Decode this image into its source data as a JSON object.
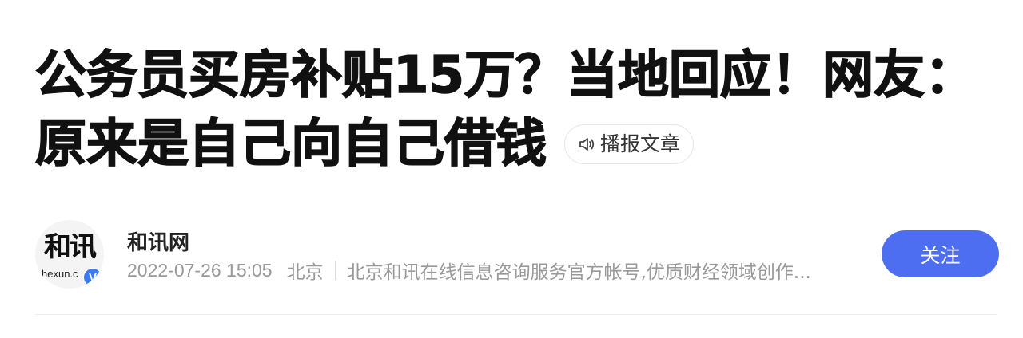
{
  "article": {
    "title_line1": "公务员买房补贴15万？当地回应！网友：",
    "title_line2": "原来是自己向自己借钱",
    "tts_button_label": "播报文章",
    "tts_icon": "speaker-icon"
  },
  "author": {
    "avatar_logo_text": "和讯",
    "avatar_sub_text": "hexun.c",
    "verified_badge": "V",
    "name": "和讯网",
    "publish_time": "2022-07-26 15:05",
    "location": "北京",
    "description": "北京和讯在线信息咨询服务官方帐号,优质财经领域创作...",
    "follow_label": "关注"
  },
  "colors": {
    "accent": "#4e6ef2",
    "verified": "#3d7bf5",
    "meta_text": "#999999",
    "title_text": "#111111"
  }
}
